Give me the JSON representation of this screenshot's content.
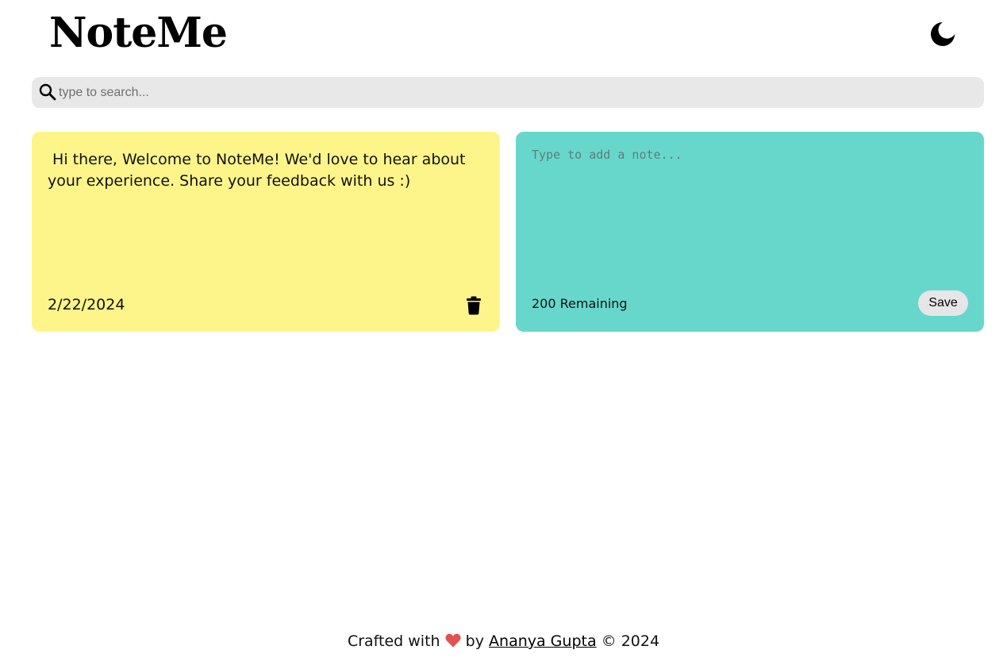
{
  "header": {
    "logo_text": "NoteMe",
    "theme_toggle_icon": "moon-icon"
  },
  "search": {
    "placeholder": "type to search...",
    "value": "",
    "icon": "search-icon"
  },
  "notes": [
    {
      "text": " Hi there, Welcome to NoteMe! We'd love to hear about your experience. Share your feedback with us :)",
      "date": "2/22/2024",
      "background": "#fef58a",
      "delete_icon": "trash-icon"
    }
  ],
  "add_note": {
    "placeholder": "Type to add a note...",
    "value": "",
    "remaining_text": "200 Remaining",
    "save_label": "Save",
    "background": "#67d7cc"
  },
  "footer": {
    "prefix": "Crafted with",
    "heart_icon": "heart-icon",
    "by": "by",
    "author": "Ananya Gupta",
    "copyright": "© 2024",
    "heart_color": "#e2524f"
  }
}
